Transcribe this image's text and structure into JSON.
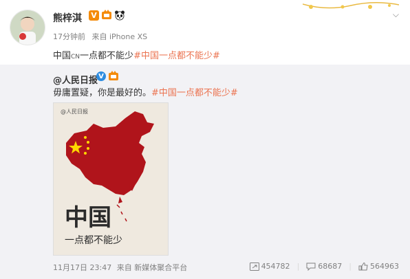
{
  "post": {
    "author": "熊梓淇",
    "time": "17分钟前",
    "source": "来自 iPhone XS",
    "text_before": "中国",
    "text_cn": "CN",
    "text_after": "一点都不能少",
    "topic": "#中国一点都不能少#"
  },
  "repost": {
    "author": "@人民日报",
    "text": "毋庸置疑，你是最好的。",
    "topic": "#中国一点都不能少#",
    "image": {
      "watermark": "@人民日报",
      "big_title": "中国",
      "subtitle": "一点都不能少"
    },
    "footer_time": "11月17日 23:47",
    "footer_source": "来自 新媒体聚合平台",
    "reposts": "454782",
    "comments": "68687",
    "likes": "564963"
  },
  "colors": {
    "topic": "#eb7350",
    "verified_orange": "#f48b0a",
    "verified_blue": "#2d8ce0",
    "map_red": "#b0141b",
    "star_yellow": "#ffd700"
  },
  "icons": [
    "vip-badge-icon",
    "fan-badge-icon",
    "panda-icon",
    "chevron-down-icon",
    "repost-icon",
    "comment-icon",
    "like-icon"
  ]
}
